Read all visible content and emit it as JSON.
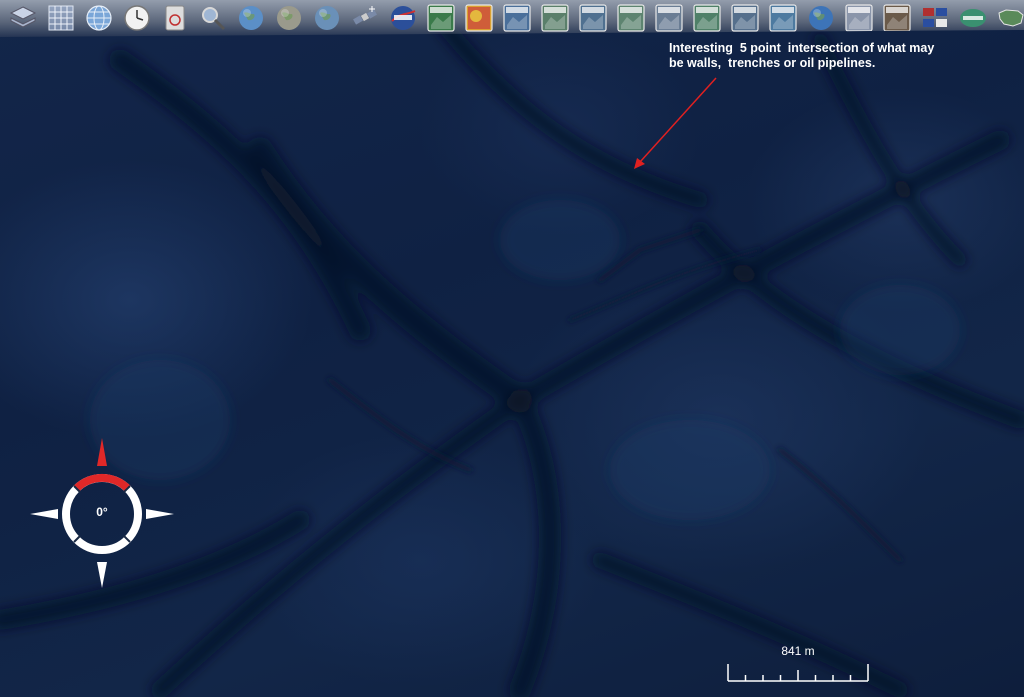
{
  "toolbar": {
    "tools": [
      {
        "name": "layers-icon",
        "color": "#c9d3e6"
      },
      {
        "name": "grid-icon",
        "color": "#9fb3d6"
      },
      {
        "name": "globe-grid-icon",
        "color": "#7aa6d8"
      },
      {
        "name": "clock-icon",
        "color": "#f2f2f2"
      },
      {
        "name": "camera-icon",
        "color": "#dddddd"
      },
      {
        "name": "magnifier-icon",
        "color": "#d8d8d8"
      },
      {
        "name": "earth-icon",
        "color": "#5b8fc7"
      },
      {
        "name": "moon-icon",
        "color": "#9a9a8c"
      },
      {
        "name": "globe-icon",
        "color": "#6a90b8"
      },
      {
        "name": "satellite-icon",
        "color": "#cccccc"
      },
      {
        "name": "nasa-logo-icon",
        "color": "#2b4f9a"
      },
      {
        "name": "wms-icon",
        "color": "#3a7a4a"
      },
      {
        "name": "weather-map-icon",
        "color": "#d9a030"
      },
      {
        "name": "map-tile-1-icon",
        "color": "#4a6f9a"
      },
      {
        "name": "map-tile-2-icon",
        "color": "#5a7f6a"
      },
      {
        "name": "map-tile-3-icon",
        "color": "#4f7090"
      },
      {
        "name": "map-tile-4-icon",
        "color": "#5d8470"
      },
      {
        "name": "map-tile-5-icon",
        "color": "#6a7d94"
      },
      {
        "name": "map-tile-6-icon",
        "color": "#4f8068"
      },
      {
        "name": "map-tile-7-icon",
        "color": "#556f8c"
      },
      {
        "name": "map-tile-8-icon",
        "color": "#4d7aa0"
      },
      {
        "name": "blue-marble-icon",
        "color": "#3d74b8"
      },
      {
        "name": "place-names-icon",
        "color": "#8a95aa"
      },
      {
        "name": "photo-tile-icon",
        "color": "#6a5a4a"
      },
      {
        "name": "flags-icon",
        "color": "#b03030"
      },
      {
        "name": "community-icon",
        "color": "#3a9070"
      },
      {
        "name": "usa-map-icon",
        "color": "#5a8a5a"
      },
      {
        "name": "settings-tile-icon",
        "color": "#7a8a7a"
      }
    ]
  },
  "annotation": {
    "text": "Interesting  5 point  intersection of what may\nbe walls,  trenches or oil pipelines.",
    "arrow_color": "#e02020"
  },
  "compass": {
    "heading_label": "0°",
    "accent_color": "#e02828"
  },
  "scale_bar": {
    "label": "841 m"
  }
}
